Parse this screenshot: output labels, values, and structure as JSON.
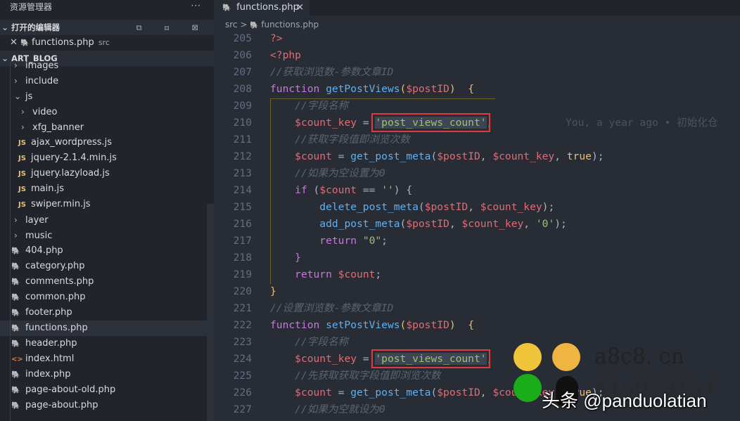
{
  "sidebar": {
    "title": "资源管理器",
    "more": "···",
    "open_editors": "打开的编辑器",
    "open_actions": "⧉ ⧈ ⊠",
    "open_file": {
      "name": "functions.php",
      "folder": "src"
    },
    "project": "ART_BLOG",
    "items": [
      {
        "label": "images",
        "depth": 1,
        "type": "folder",
        "open": false
      },
      {
        "label": "include",
        "depth": 1,
        "type": "folder",
        "open": false
      },
      {
        "label": "js",
        "depth": 1,
        "type": "folder",
        "open": true
      },
      {
        "label": "video",
        "depth": 2,
        "type": "folder",
        "open": false
      },
      {
        "label": "xfg_banner",
        "depth": 2,
        "type": "folder",
        "open": false
      },
      {
        "label": "ajax_wordpress.js",
        "depth": 2,
        "type": "js"
      },
      {
        "label": "jquery-2.1.4.min.js",
        "depth": 2,
        "type": "js"
      },
      {
        "label": "jquery.lazyload.js",
        "depth": 2,
        "type": "js"
      },
      {
        "label": "main.js",
        "depth": 2,
        "type": "js"
      },
      {
        "label": "swiper.min.js",
        "depth": 2,
        "type": "js"
      },
      {
        "label": "layer",
        "depth": 1,
        "type": "folder",
        "open": false
      },
      {
        "label": "music",
        "depth": 1,
        "type": "folder",
        "open": false
      },
      {
        "label": "404.php",
        "depth": 1,
        "type": "php"
      },
      {
        "label": "category.php",
        "depth": 1,
        "type": "php"
      },
      {
        "label": "comments.php",
        "depth": 1,
        "type": "php"
      },
      {
        "label": "common.php",
        "depth": 1,
        "type": "php"
      },
      {
        "label": "footer.php",
        "depth": 1,
        "type": "php"
      },
      {
        "label": "functions.php",
        "depth": 1,
        "type": "php",
        "selected": true
      },
      {
        "label": "header.php",
        "depth": 1,
        "type": "php"
      },
      {
        "label": "index.html",
        "depth": 1,
        "type": "html"
      },
      {
        "label": "index.php",
        "depth": 1,
        "type": "php"
      },
      {
        "label": "page-about-old.php",
        "depth": 1,
        "type": "php"
      },
      {
        "label": "page-about.php",
        "depth": 1,
        "type": "php"
      }
    ]
  },
  "tab": {
    "label": "functions.php",
    "close": "×"
  },
  "breadcrumb": {
    "folder": "src",
    "sep": ">",
    "file": "functions.php"
  },
  "blame": "You, a year ago • 初始化仓",
  "code": [
    {
      "n": "205",
      "t": [
        [
          "tag",
          "?>"
        ]
      ]
    },
    {
      "n": "206",
      "t": [
        [
          "tag",
          "<?php"
        ]
      ]
    },
    {
      "n": "207",
      "t": [
        [
          "cm",
          "//获取浏览数-参数文章ID"
        ]
      ]
    },
    {
      "n": "208",
      "t": [
        [
          "kw",
          "function "
        ],
        [
          "fn",
          "getPostViews"
        ],
        [
          "br",
          "("
        ],
        [
          "var",
          "$postID"
        ],
        [
          "br",
          ")"
        ],
        [
          "",
          "  "
        ],
        [
          "br",
          "{"
        ]
      ]
    },
    {
      "n": "209",
      "t": [
        [
          "",
          "    "
        ],
        [
          "cm",
          "//字段名称"
        ]
      ]
    },
    {
      "n": "210",
      "t": [
        [
          "",
          "    "
        ],
        [
          "var",
          "$count_key"
        ],
        [
          "",
          " = "
        ],
        [
          "str hl",
          "'post_views_count'"
        ],
        [
          "",
          ";"
        ]
      ],
      "blame": true
    },
    {
      "n": "211",
      "t": [
        [
          "",
          "    "
        ],
        [
          "cm",
          "//获取字段值即浏览次数"
        ]
      ]
    },
    {
      "n": "212",
      "t": [
        [
          "",
          "    "
        ],
        [
          "var",
          "$count"
        ],
        [
          "",
          " = "
        ],
        [
          "fn",
          "get_post_meta"
        ],
        [
          "",
          "("
        ],
        [
          "var",
          "$postID"
        ],
        [
          "",
          ", "
        ],
        [
          "var",
          "$count_key"
        ],
        [
          "",
          ", "
        ],
        [
          "br",
          "true"
        ],
        [
          "",
          ");"
        ]
      ]
    },
    {
      "n": "213",
      "t": [
        [
          "",
          "    "
        ],
        [
          "cm",
          "//如果为空设置为0"
        ]
      ]
    },
    {
      "n": "214",
      "t": [
        [
          "",
          "    "
        ],
        [
          "kw",
          "if"
        ],
        [
          "",
          " ("
        ],
        [
          "var",
          "$count"
        ],
        [
          "",
          " == "
        ],
        [
          "str",
          "''"
        ],
        [
          "",
          ") {"
        ]
      ]
    },
    {
      "n": "215",
      "t": [
        [
          "",
          "        "
        ],
        [
          "fn",
          "delete_post_meta"
        ],
        [
          "",
          "("
        ],
        [
          "var",
          "$postID"
        ],
        [
          "",
          ", "
        ],
        [
          "var",
          "$count_key"
        ],
        [
          "",
          ");"
        ]
      ]
    },
    {
      "n": "216",
      "t": [
        [
          "",
          "        "
        ],
        [
          "fn",
          "add_post_meta"
        ],
        [
          "",
          "("
        ],
        [
          "var",
          "$postID"
        ],
        [
          "",
          ", "
        ],
        [
          "var",
          "$count_key"
        ],
        [
          "",
          ", "
        ],
        [
          "str",
          "'0'"
        ],
        [
          "",
          ");"
        ]
      ]
    },
    {
      "n": "217",
      "t": [
        [
          "",
          "        "
        ],
        [
          "kw",
          "return "
        ],
        [
          "str",
          "\"0\""
        ],
        [
          "",
          ";"
        ]
      ]
    },
    {
      "n": "218",
      "t": [
        [
          "",
          "    "
        ],
        [
          "kw",
          "}"
        ]
      ]
    },
    {
      "n": "219",
      "t": [
        [
          "",
          "    "
        ],
        [
          "kw",
          "return "
        ],
        [
          "var",
          "$count"
        ],
        [
          "",
          ";"
        ]
      ]
    },
    {
      "n": "220",
      "t": [
        [
          "br",
          "}"
        ]
      ]
    },
    {
      "n": "221",
      "t": [
        [
          "cm",
          "//设置浏览数-参数文章ID"
        ]
      ]
    },
    {
      "n": "222",
      "t": [
        [
          "kw",
          "function "
        ],
        [
          "fn",
          "setPostViews"
        ],
        [
          "br",
          "("
        ],
        [
          "var",
          "$postID"
        ],
        [
          "br",
          ")"
        ],
        [
          "",
          "  "
        ],
        [
          "br",
          "{"
        ]
      ]
    },
    {
      "n": "223",
      "t": [
        [
          "",
          "    "
        ],
        [
          "cm",
          "//字段名称"
        ]
      ]
    },
    {
      "n": "224",
      "t": [
        [
          "",
          "    "
        ],
        [
          "var",
          "$count_key"
        ],
        [
          "",
          " = "
        ],
        [
          "str hl",
          "'post_views_count'"
        ],
        [
          "",
          ";"
        ]
      ]
    },
    {
      "n": "225",
      "t": [
        [
          "",
          "    "
        ],
        [
          "cm",
          "//先获取获取字段值即浏览次数"
        ]
      ]
    },
    {
      "n": "226",
      "t": [
        [
          "",
          "    "
        ],
        [
          "var",
          "$count"
        ],
        [
          "",
          " = "
        ],
        [
          "fn",
          "get_post_meta"
        ],
        [
          "",
          "("
        ],
        [
          "var",
          "$postID"
        ],
        [
          "",
          ", "
        ],
        [
          "var",
          "$count_key"
        ],
        [
          "",
          ", "
        ],
        [
          "br",
          "true"
        ],
        [
          "",
          ");"
        ]
      ]
    },
    {
      "n": "227",
      "t": [
        [
          "",
          "    "
        ],
        [
          "cm",
          "//如果为空就设为0"
        ]
      ]
    }
  ],
  "watermark": {
    "site": "a8c8. cn",
    "qq": "416070154",
    "author": "头条 @panduolatian"
  }
}
